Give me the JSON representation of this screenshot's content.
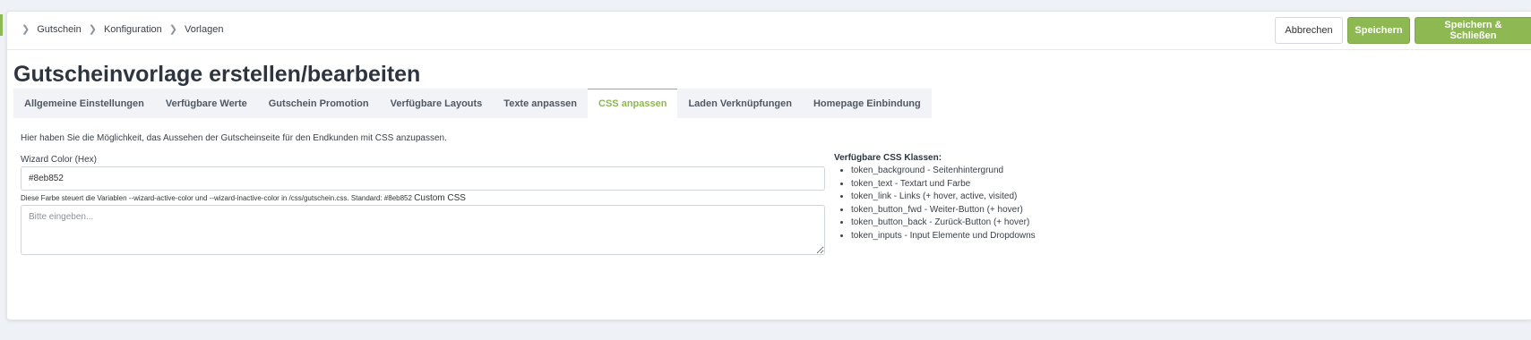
{
  "breadcrumb": [
    "Gutschein",
    "Konfiguration",
    "Vorlagen"
  ],
  "actions": {
    "cancel": "Abbrechen",
    "save": "Speichern",
    "save_close": "Speichern & Schließen"
  },
  "page_title": "Gutscheinvorlage erstellen/bearbeiten",
  "tabs": [
    "Allgemeine Einstellungen",
    "Verfügbare Werte",
    "Gutschein Promotion",
    "Verfügbare Layouts",
    "Texte anpassen",
    "CSS anpassen",
    "Laden Verknüpfungen",
    "Homepage Einbindung"
  ],
  "active_tab": "CSS anpassen",
  "intro": "Hier haben Sie die Möglichkeit, das Aussehen der Gutscheinseite für den Endkunden mit CSS anzupassen.",
  "wizard_color": {
    "label": "Wizard Color (Hex)",
    "value": "#8eb852",
    "help": "Diese Farbe steuert die Variablen --wizard-active-color und --wizard-inactive-color in /css/gutschein.css. Standard: #8eb852",
    "custom_label": "Custom CSS"
  },
  "custom_css": {
    "placeholder": "Bitte eingeben..."
  },
  "css_classes": {
    "title": "Verfügbare CSS Klassen:",
    "items": [
      "token_background - Seitenhintergrund",
      "token_text - Textart und Farbe",
      "token_link - Links (+ hover, active, visited)",
      "token_button_fwd - Weiter-Button (+ hover)",
      "token_button_back - Zurück-Button (+ hover)",
      "token_inputs - Input Elemente und Dropdowns"
    ]
  },
  "colors": {
    "accent": "#8eb852",
    "background": "#eef1f5"
  }
}
